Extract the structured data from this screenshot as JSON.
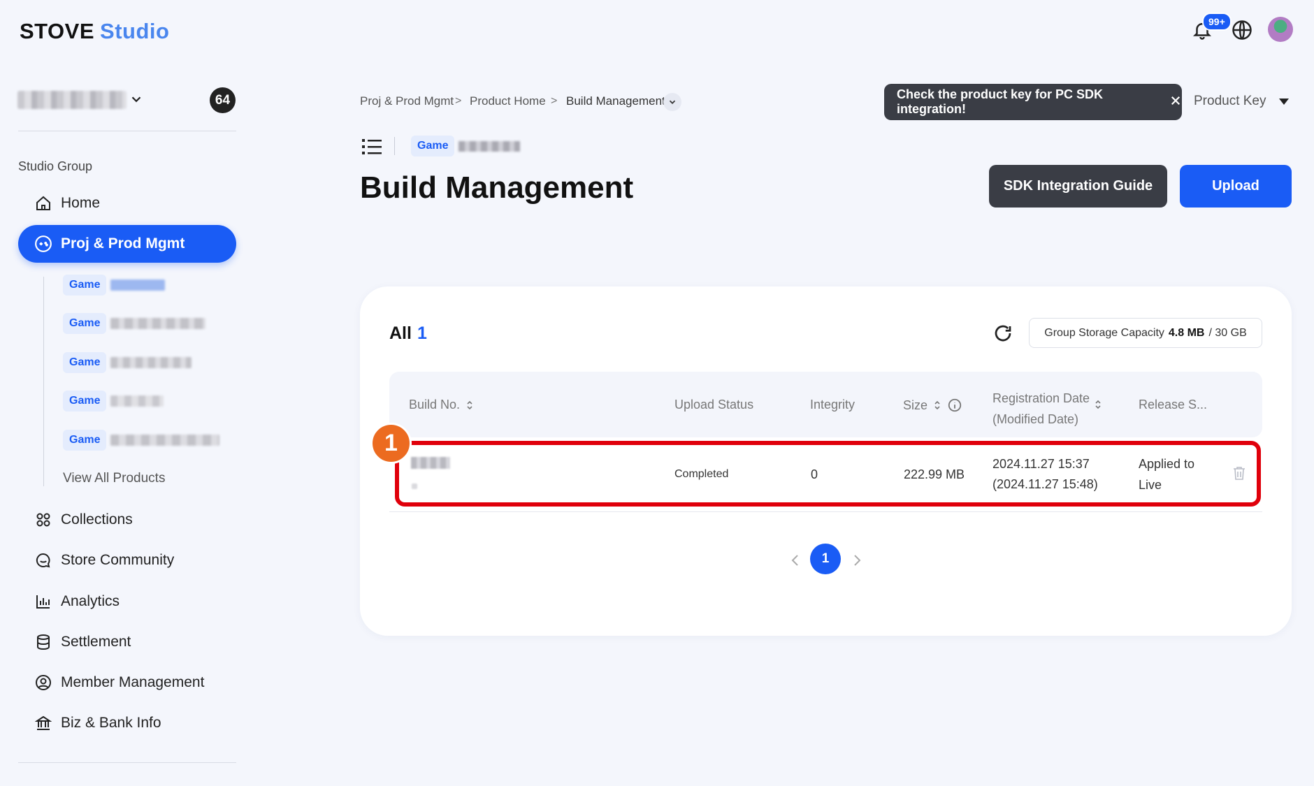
{
  "header": {
    "logo_primary": "STOVE",
    "logo_secondary": "Studio",
    "notification_badge": "99+",
    "icons": [
      "bell-icon",
      "globe-icon",
      "avatar"
    ]
  },
  "sidebar": {
    "org_count": "64",
    "group_label": "Studio Group",
    "nav": [
      {
        "label": "Home",
        "icon": "home-icon"
      },
      {
        "label": "Proj & Prod Mgmt",
        "icon": "gamepad-icon",
        "active": true
      },
      {
        "label": "Collections",
        "icon": "collections-icon"
      },
      {
        "label": "Store Community",
        "icon": "community-icon"
      },
      {
        "label": "Analytics",
        "icon": "chart-icon"
      },
      {
        "label": "Settlement",
        "icon": "database-icon"
      },
      {
        "label": "Member Management",
        "icon": "user-circle-icon"
      },
      {
        "label": "Biz & Bank Info",
        "icon": "bank-icon"
      }
    ],
    "products": [
      {
        "tag": "Game"
      },
      {
        "tag": "Game"
      },
      {
        "tag": "Game"
      },
      {
        "tag": "Game"
      },
      {
        "tag": "Game"
      }
    ],
    "view_all": "View All Products"
  },
  "breadcrumb": [
    "Proj & Prod Mgmt",
    "Product Home",
    "Build Management"
  ],
  "tooltip": "Check the product key for PC SDK integration!",
  "product_key_label": "Product Key",
  "product_tag": "Game",
  "page_title": "Build Management",
  "buttons": {
    "sdk_guide": "SDK Integration Guide",
    "upload": "Upload"
  },
  "list": {
    "all_label": "All",
    "all_count": "1",
    "storage_label": "Group Storage Capacity",
    "storage_used": "4.8 MB",
    "storage_total": "/ 30 GB",
    "columns": {
      "build_no": "Build No.",
      "upload_status": "Upload Status",
      "integrity": "Integrity",
      "size": "Size",
      "reg_date_1": "Registration Date",
      "reg_date_2": "(Modified Date)",
      "release": "Release S..."
    },
    "rows": [
      {
        "upload_status": "Completed",
        "integrity": "0",
        "size": "222.99 MB",
        "reg_date": "2024.11.27 15:37",
        "mod_date": "(2024.11.27 15:48)",
        "release_1": "Applied to",
        "release_2": "Live"
      }
    ]
  },
  "annotation_marker": "1",
  "pagination": {
    "current": "1"
  },
  "colors": {
    "accent": "#1a5cf5",
    "dark_button": "#3a3d45",
    "highlight": "#e0000b",
    "marker": "#ec6b20"
  }
}
